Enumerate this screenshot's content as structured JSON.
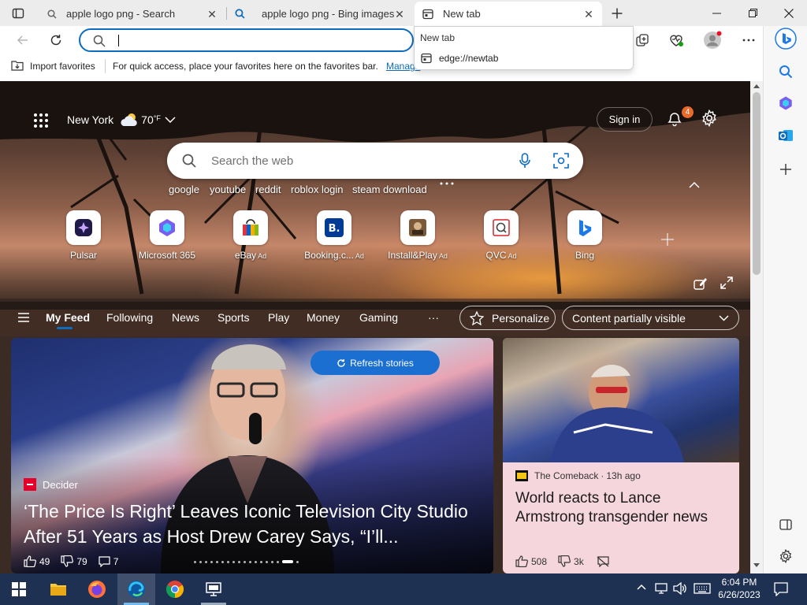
{
  "tabs": [
    {
      "title": "apple logo png - Search",
      "active": false
    },
    {
      "title": "apple logo png - Bing images",
      "active": false
    },
    {
      "title": "New tab",
      "active": true
    }
  ],
  "address_bar": {
    "value": ""
  },
  "dropdown": {
    "header": "New tab",
    "suggestion": "edge://newtab"
  },
  "favorites_bar": {
    "import_label": "Import favorites",
    "message": "For quick access, place your favorites here on the favorites bar.",
    "manage_link": "Manage"
  },
  "weather": {
    "city": "New York",
    "temp": "70",
    "unit": "°F"
  },
  "header": {
    "sign_in": "Sign in",
    "notifications_count": "4"
  },
  "search": {
    "placeholder": "Search the web"
  },
  "quick_links": [
    "google",
    "youtube",
    "reddit",
    "roblox login",
    "steam download"
  ],
  "tiles": [
    {
      "name": "Pulsar",
      "ad": false
    },
    {
      "name": "Microsoft 365",
      "ad": false
    },
    {
      "name": "eBay",
      "ad": true
    },
    {
      "name": "Booking.c...",
      "ad": true
    },
    {
      "name": "Install&Play",
      "ad": true
    },
    {
      "name": "QVC",
      "ad": true
    },
    {
      "name": "Bing",
      "ad": false
    }
  ],
  "ad_label": "Ad",
  "feed_nav": {
    "items": [
      "My Feed",
      "Following",
      "News",
      "Sports",
      "Play",
      "Money",
      "Gaming"
    ],
    "more": "···",
    "personalize": "Personalize",
    "content_visibility": "Content partially visible"
  },
  "refresh_label": "Refresh stories",
  "main_story": {
    "source": "Decider",
    "headline": "‘The Price Is Right’ Leaves Iconic Television City Studio After 51 Years as Host Drew Carey Says, “I’ll...",
    "likes": "49",
    "dislikes": "79",
    "comments": "7"
  },
  "side_story": {
    "source": "The Comeback",
    "age": "13h ago",
    "headline": "World reacts to Lance Armstrong transgender news",
    "likes": "508",
    "dislikes": "3k"
  },
  "clock": {
    "time": "6:04 PM",
    "date": "6/26/2023"
  },
  "colors": {
    "accent": "#0f6cbd",
    "taskbar": "#1f3152",
    "side_card_bg": "#f6d6dd"
  }
}
